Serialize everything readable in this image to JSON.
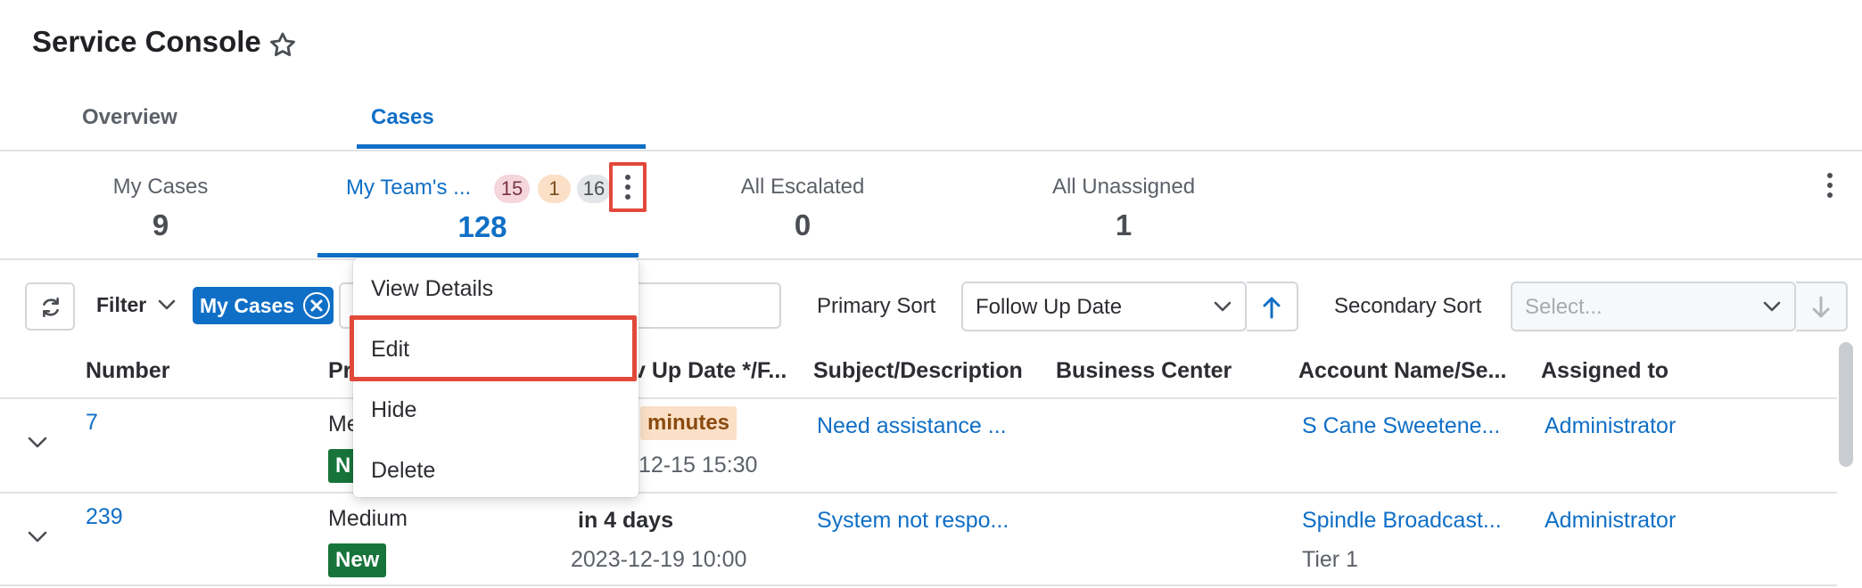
{
  "header": {
    "title": "Service Console",
    "favorite_icon": "star-outline-icon"
  },
  "main_tabs": [
    {
      "label": "Overview",
      "active": false
    },
    {
      "label": "Cases",
      "active": true
    }
  ],
  "queues": [
    {
      "label": "My Cases",
      "count": "9",
      "active": false
    },
    {
      "label": "My Team's ...",
      "count": "128",
      "active": true,
      "badges": [
        "15",
        "1",
        "16"
      ]
    },
    {
      "label": "All Escalated",
      "count": "0",
      "active": false
    },
    {
      "label": "All Unassigned",
      "count": "1",
      "active": false
    }
  ],
  "filter_bar": {
    "filter_label": "Filter",
    "active_chip": "My Cases",
    "primary_sort_label": "Primary Sort",
    "primary_sort_value": "Follow Up Date",
    "secondary_sort_label": "Secondary Sort",
    "secondary_sort_placeholder": "Select..."
  },
  "context_menu": {
    "items": [
      "View Details",
      "Edit",
      "Hide",
      "Delete"
    ],
    "highlighted": "Edit"
  },
  "table": {
    "columns": [
      "Number",
      "Pr",
      "v Up Date */F...",
      "Subject/Description",
      "Business Center",
      "Account Name/Se...",
      "Assigned to"
    ],
    "rows": [
      {
        "number": "7",
        "priority": "Me",
        "status": "N",
        "due_badge": "minutes",
        "follow_up": "12-15 15:30",
        "subject": "Need assistance ...",
        "account": "S Cane Sweetene...",
        "account_tier": "",
        "assigned": "Administrator"
      },
      {
        "number": "239",
        "priority": "Medium",
        "status": "New",
        "due_text": "in 4 days",
        "follow_up": "2023-12-19 10:00",
        "subject": "System not respo...",
        "account": "Spindle Broadcast...",
        "account_tier": "Tier 1",
        "assigned": "Administrator"
      }
    ]
  },
  "colors": {
    "accent": "#0f6fc6",
    "highlight": "#e2493a",
    "status_new": "#17743a"
  }
}
